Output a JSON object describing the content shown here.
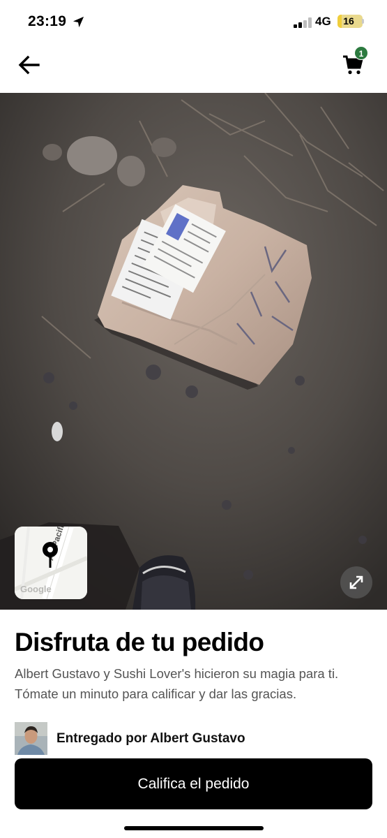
{
  "status_bar": {
    "time": "23:19",
    "network": "4G",
    "battery": "16",
    "battery_level": 0.16,
    "signal_bars_active": 2,
    "signal_bars_total": 4,
    "icons": [
      "location-arrow-icon",
      "signal-icon",
      "battery-icon"
    ]
  },
  "nav": {
    "back_icon": "arrow-left-icon",
    "cart_icon": "cart-icon",
    "cart_count": "1",
    "badge_color": "#2c7a3f"
  },
  "photo": {
    "subject": "delivered-order-package",
    "map_street_label": "Av. Pacific",
    "map_attribution": "Google",
    "map_pin_icon": "map-pin-icon",
    "expand_icon": "expand-arrows-icon"
  },
  "order": {
    "title": "Disfruta de tu pedido",
    "description": "Albert Gustavo y Sushi Lover's hicieron su magia para ti. Tómate un minuto para calificar y dar las gracias.",
    "delivered_by": "Entregado por Albert Gustavo",
    "rate_button_label": "Califica el pedido"
  },
  "colors": {
    "primary_button": "#000000",
    "text_secondary": "#545454",
    "battery": "#f0ce3c"
  }
}
